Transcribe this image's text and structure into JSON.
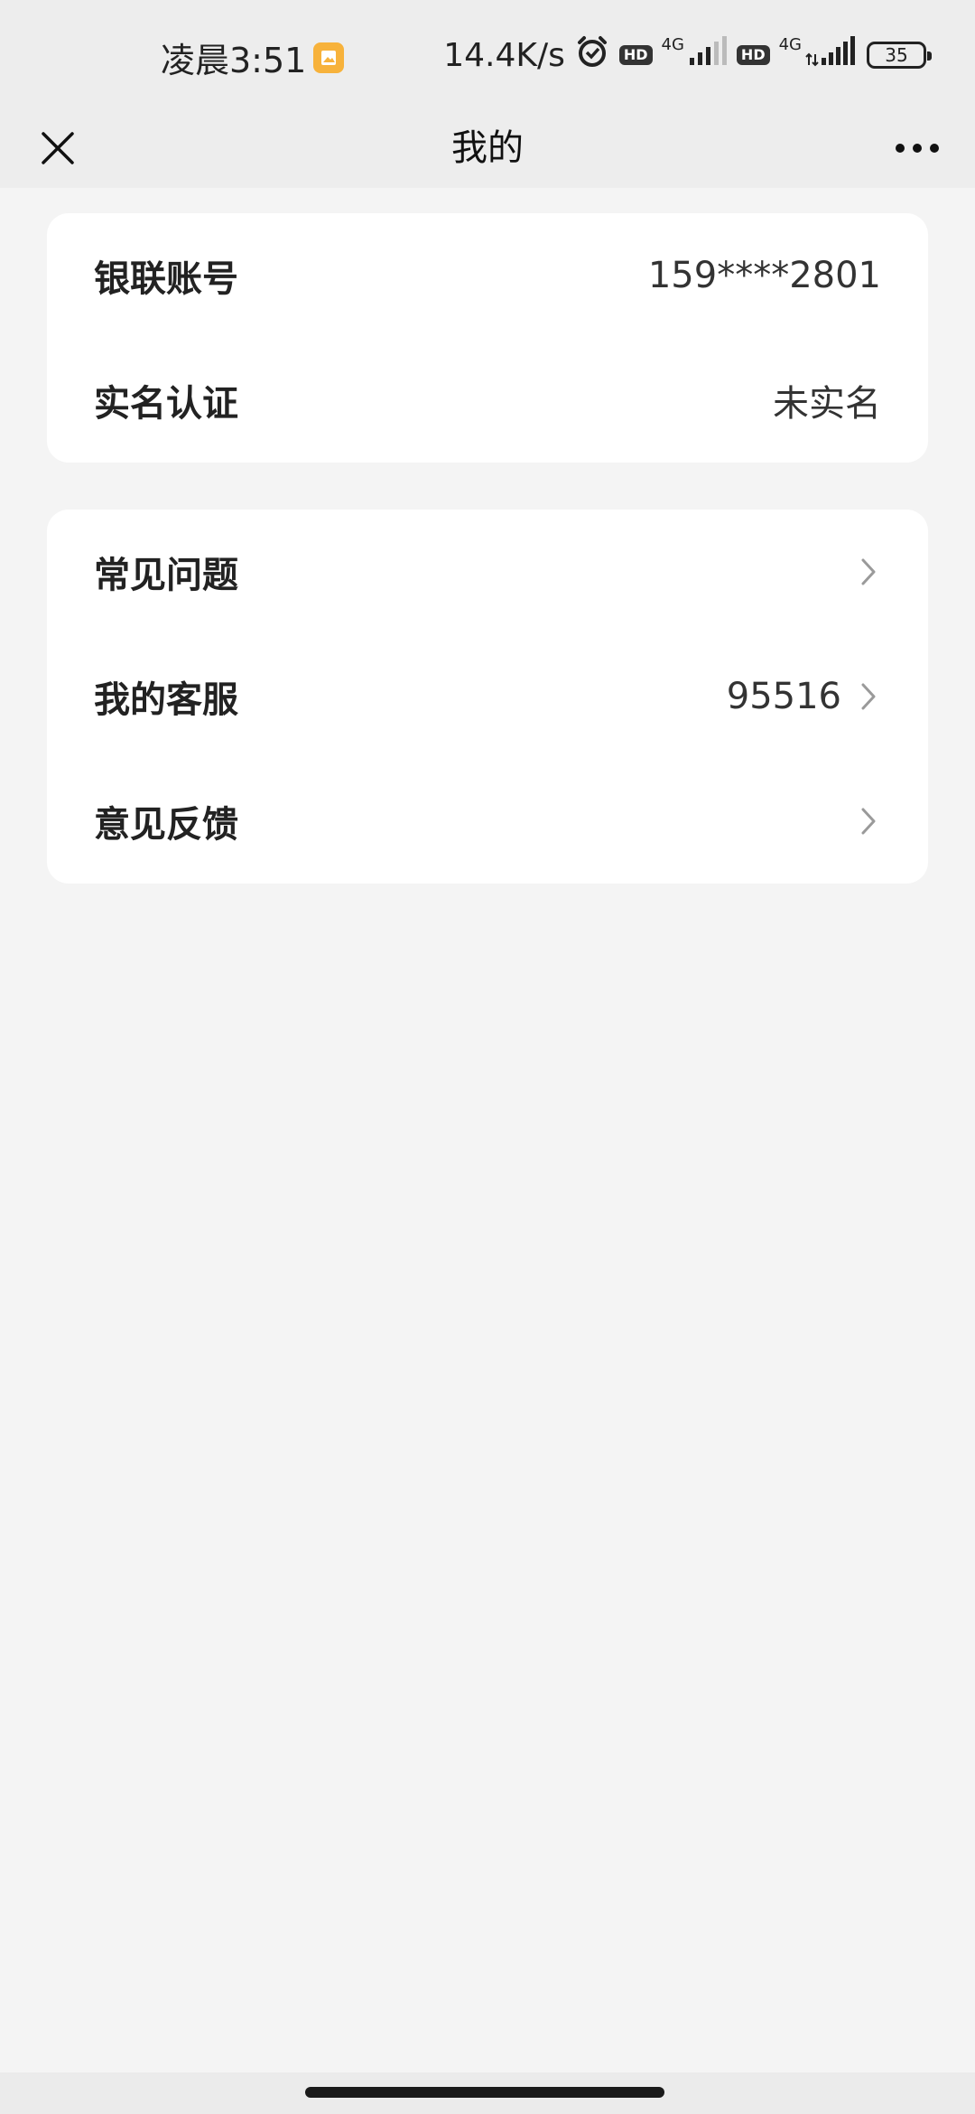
{
  "status_bar": {
    "time": "凌晨3:51",
    "notification_icon": "gallery-notification-icon",
    "net_speed": "14.4K/s",
    "alarm_icon": "alarm-icon",
    "hd1": "HD",
    "net1": "4G",
    "hd2": "HD",
    "net2": "4G",
    "battery": "35"
  },
  "nav": {
    "close_icon": "close-icon",
    "title": "我的",
    "more_icon": "more-icon"
  },
  "account_card": {
    "items": [
      {
        "label": "银联账号",
        "value": "159****2801"
      },
      {
        "label": "实名认证",
        "value": "未实名"
      }
    ]
  },
  "service_card": {
    "items": [
      {
        "label": "常见问题",
        "value": ""
      },
      {
        "label": "我的客服",
        "value": "95516"
      },
      {
        "label": "意见反馈",
        "value": ""
      }
    ]
  },
  "colors": {
    "page_bg": "#f4f4f4",
    "header_bg": "#ededed",
    "card_bg": "#ffffff",
    "chevron": "#9a9a9a"
  }
}
